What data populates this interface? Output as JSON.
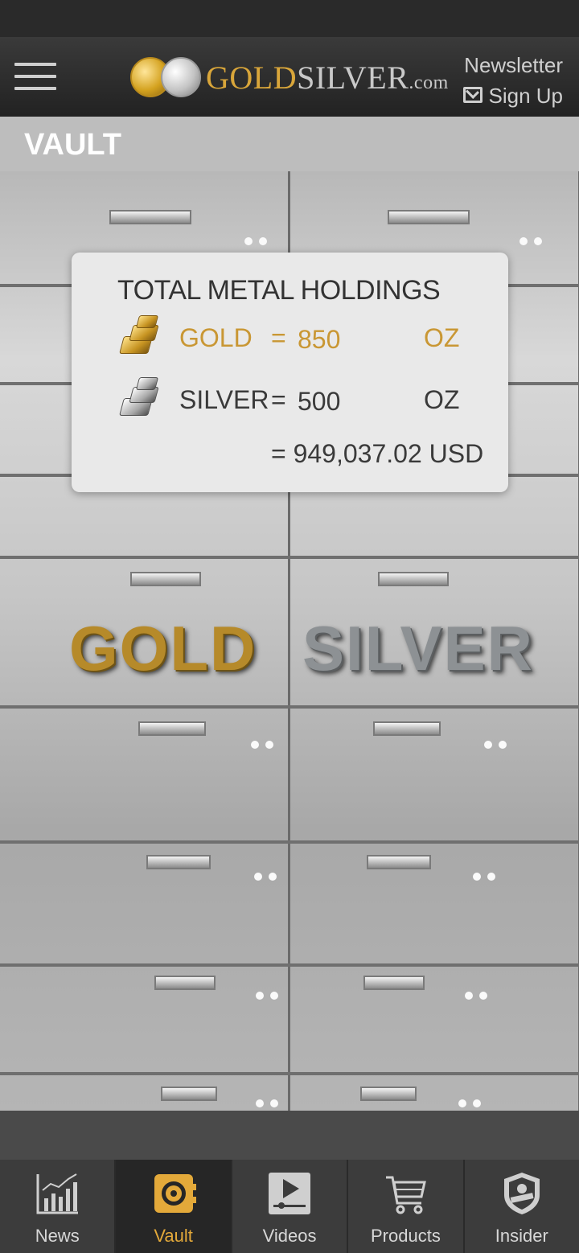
{
  "header": {
    "logo": {
      "gold_word": "GOLD",
      "silver_word": "SILVER",
      "suffix": ".com"
    },
    "newsletter_line1": "Newsletter",
    "newsletter_line2": "Sign Up"
  },
  "page": {
    "title": "VAULT"
  },
  "vault_graphics": {
    "gold_word": "GOLD",
    "silver_word": "SILVER"
  },
  "holdings": {
    "title": "TOTAL METAL HOLDINGS",
    "gold": {
      "label": "GOLD",
      "equals": "=",
      "amount": "850",
      "unit": "OZ"
    },
    "silver": {
      "label": "SILVER",
      "equals": "=",
      "amount": "500",
      "unit": "OZ"
    },
    "total": "= 949,037.02 USD"
  },
  "tabs": [
    {
      "label": "News",
      "icon": "chart-icon",
      "active": false
    },
    {
      "label": "Vault",
      "icon": "vault-icon",
      "active": true
    },
    {
      "label": "Videos",
      "icon": "play-icon",
      "active": false
    },
    {
      "label": "Products",
      "icon": "cart-icon",
      "active": false
    },
    {
      "label": "Insider",
      "icon": "shield-badge-icon",
      "active": false
    }
  ],
  "colors": {
    "accent_gold": "#e3a93a",
    "header_bg": "#2a2a2a",
    "card_bg": "#e9e9e9"
  }
}
